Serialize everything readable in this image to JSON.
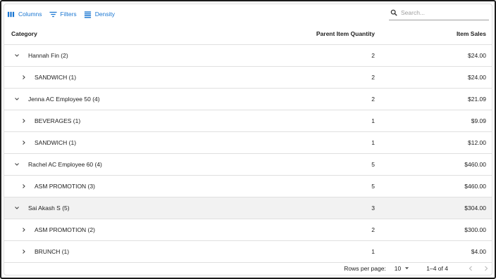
{
  "toolbar": {
    "columns_label": "Columns",
    "filters_label": "Filters",
    "density_label": "Density",
    "accent_color": "#1976d2"
  },
  "search": {
    "placeholder": "Search..."
  },
  "table": {
    "columns": [
      "Category",
      "Parent Item Quantity",
      "Item Sales"
    ],
    "rows": [
      {
        "label": "Hannah Fin (2)",
        "qty": "2",
        "sales": "$24.00",
        "level": 0,
        "expanded": true,
        "highlighted": false
      },
      {
        "label": "SANDWICH (1)",
        "qty": "2",
        "sales": "$24.00",
        "level": 1,
        "expanded": false,
        "highlighted": false
      },
      {
        "label": "Jenna AC Employee 50 (4)",
        "qty": "2",
        "sales": "$21.09",
        "level": 0,
        "expanded": true,
        "highlighted": false
      },
      {
        "label": "BEVERAGES (1)",
        "qty": "1",
        "sales": "$9.09",
        "level": 1,
        "expanded": false,
        "highlighted": false
      },
      {
        "label": "SANDWICH (1)",
        "qty": "1",
        "sales": "$12.00",
        "level": 1,
        "expanded": false,
        "highlighted": false
      },
      {
        "label": "Rachel AC Employee 60 (4)",
        "qty": "5",
        "sales": "$460.00",
        "level": 0,
        "expanded": true,
        "highlighted": false
      },
      {
        "label": "ASM PROMOTION (3)",
        "qty": "5",
        "sales": "$460.00",
        "level": 1,
        "expanded": false,
        "highlighted": false
      },
      {
        "label": "Sai Akash S (5)",
        "qty": "3",
        "sales": "$304.00",
        "level": 0,
        "expanded": true,
        "highlighted": true
      },
      {
        "label": "ASM PROMOTION (2)",
        "qty": "2",
        "sales": "$300.00",
        "level": 1,
        "expanded": false,
        "highlighted": false
      },
      {
        "label": "BRUNCH (1)",
        "qty": "1",
        "sales": "$4.00",
        "level": 1,
        "expanded": false,
        "highlighted": false
      }
    ]
  },
  "footer": {
    "rows_per_page_label": "Rows per page:",
    "rows_per_page_value": "10",
    "range_text": "1–4 of 4"
  }
}
